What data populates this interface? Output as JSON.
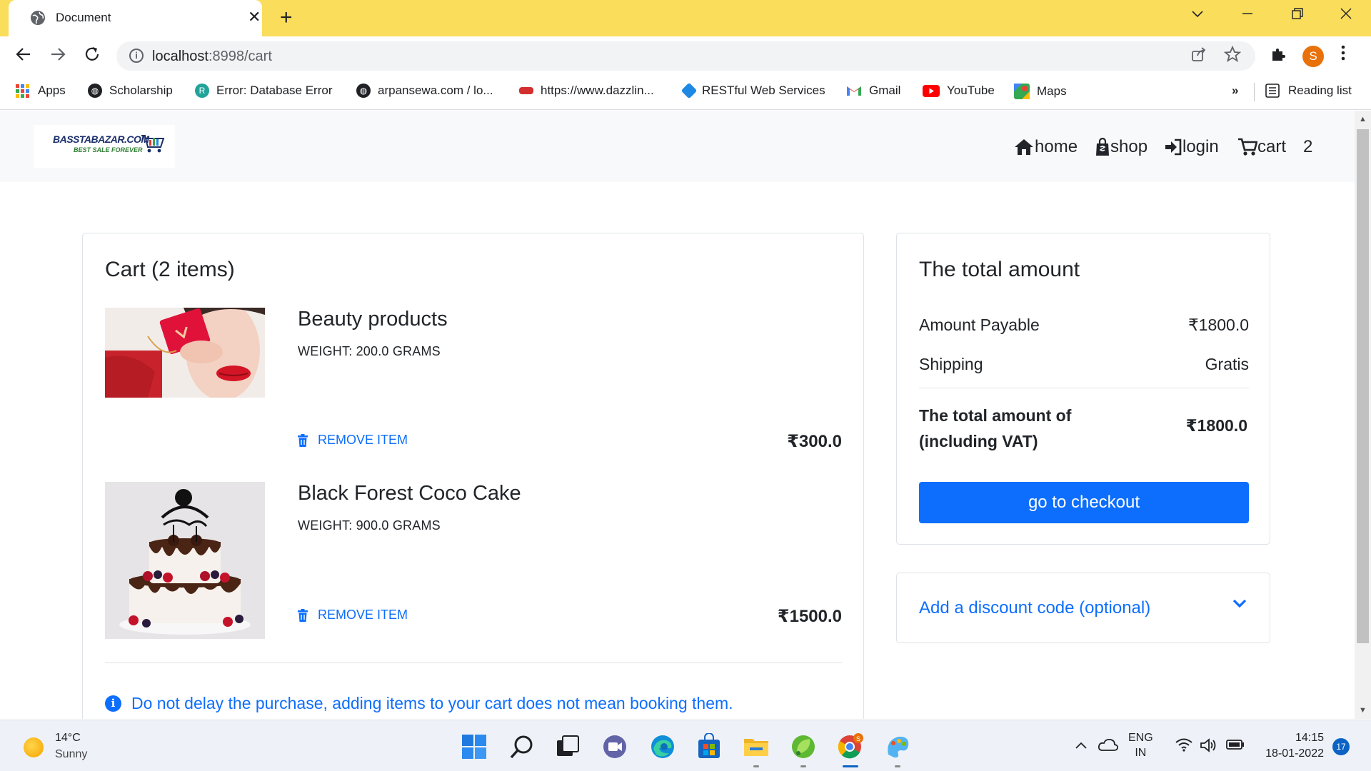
{
  "browser": {
    "tab_title": "Document",
    "tab_close": "✕",
    "new_tab": "+",
    "url_host": "localhost",
    "url_rest": ":8998/cart",
    "profile_initial": "S",
    "bookmarks": [
      {
        "label": "Apps",
        "icon": "apps-grid-icon"
      },
      {
        "label": "Scholarship",
        "icon": "globe-icon"
      },
      {
        "label": "Error: Database Error",
        "icon": "db-icon"
      },
      {
        "label": "arpansewa.com / lo...",
        "icon": "globe-icon"
      },
      {
        "label": "https://www.dazzlin...",
        "icon": "dazzling-icon"
      },
      {
        "label": "RESTful Web Services",
        "icon": "rest-icon"
      },
      {
        "label": "Gmail",
        "icon": "gmail-icon"
      },
      {
        "label": "YouTube",
        "icon": "youtube-icon"
      },
      {
        "label": "Maps",
        "icon": "maps-icon"
      }
    ],
    "overflow": "»",
    "reading_list": "Reading list"
  },
  "site": {
    "logo_top": "BASSTABAZAR.COM",
    "logo_bottom": "BEST SALE FOREVER",
    "nav": {
      "home": "home",
      "shop": "shop",
      "login": "login",
      "cart": "cart",
      "cart_count": "2"
    }
  },
  "cart": {
    "title": "Cart (2 items)",
    "items": [
      {
        "name": "Beauty products",
        "weight": "WEIGHT: 200.0 GRAMS",
        "remove": "REMOVE ITEM",
        "price": "₹300.0"
      },
      {
        "name": "Black Forest Coco Cake",
        "weight": "WEIGHT: 900.0 GRAMS",
        "remove": "REMOVE ITEM",
        "price": "₹1500.0"
      }
    ],
    "notice": "Do not delay the purchase, adding items to your cart does not mean booking them."
  },
  "summary": {
    "title": "The total amount",
    "amount_payable_label": "Amount Payable",
    "amount_payable_value": "₹1800.0",
    "shipping_label": "Shipping",
    "shipping_value": "Gratis",
    "total_label": "The total amount of (including VAT)",
    "total_value": "₹1800.0",
    "checkout": "go to checkout"
  },
  "discount": {
    "label": "Add a discount code (optional)"
  },
  "taskbar": {
    "temp": "14°C",
    "condition": "Sunny",
    "lang_top": "ENG",
    "lang_bottom": "IN",
    "time": "14:15",
    "date": "18-01-2022",
    "notifications": "17"
  },
  "colors": {
    "tab_strip": "#f9dd5b",
    "primary": "#0d6efd",
    "nav_bg": "#f8f9fa"
  }
}
